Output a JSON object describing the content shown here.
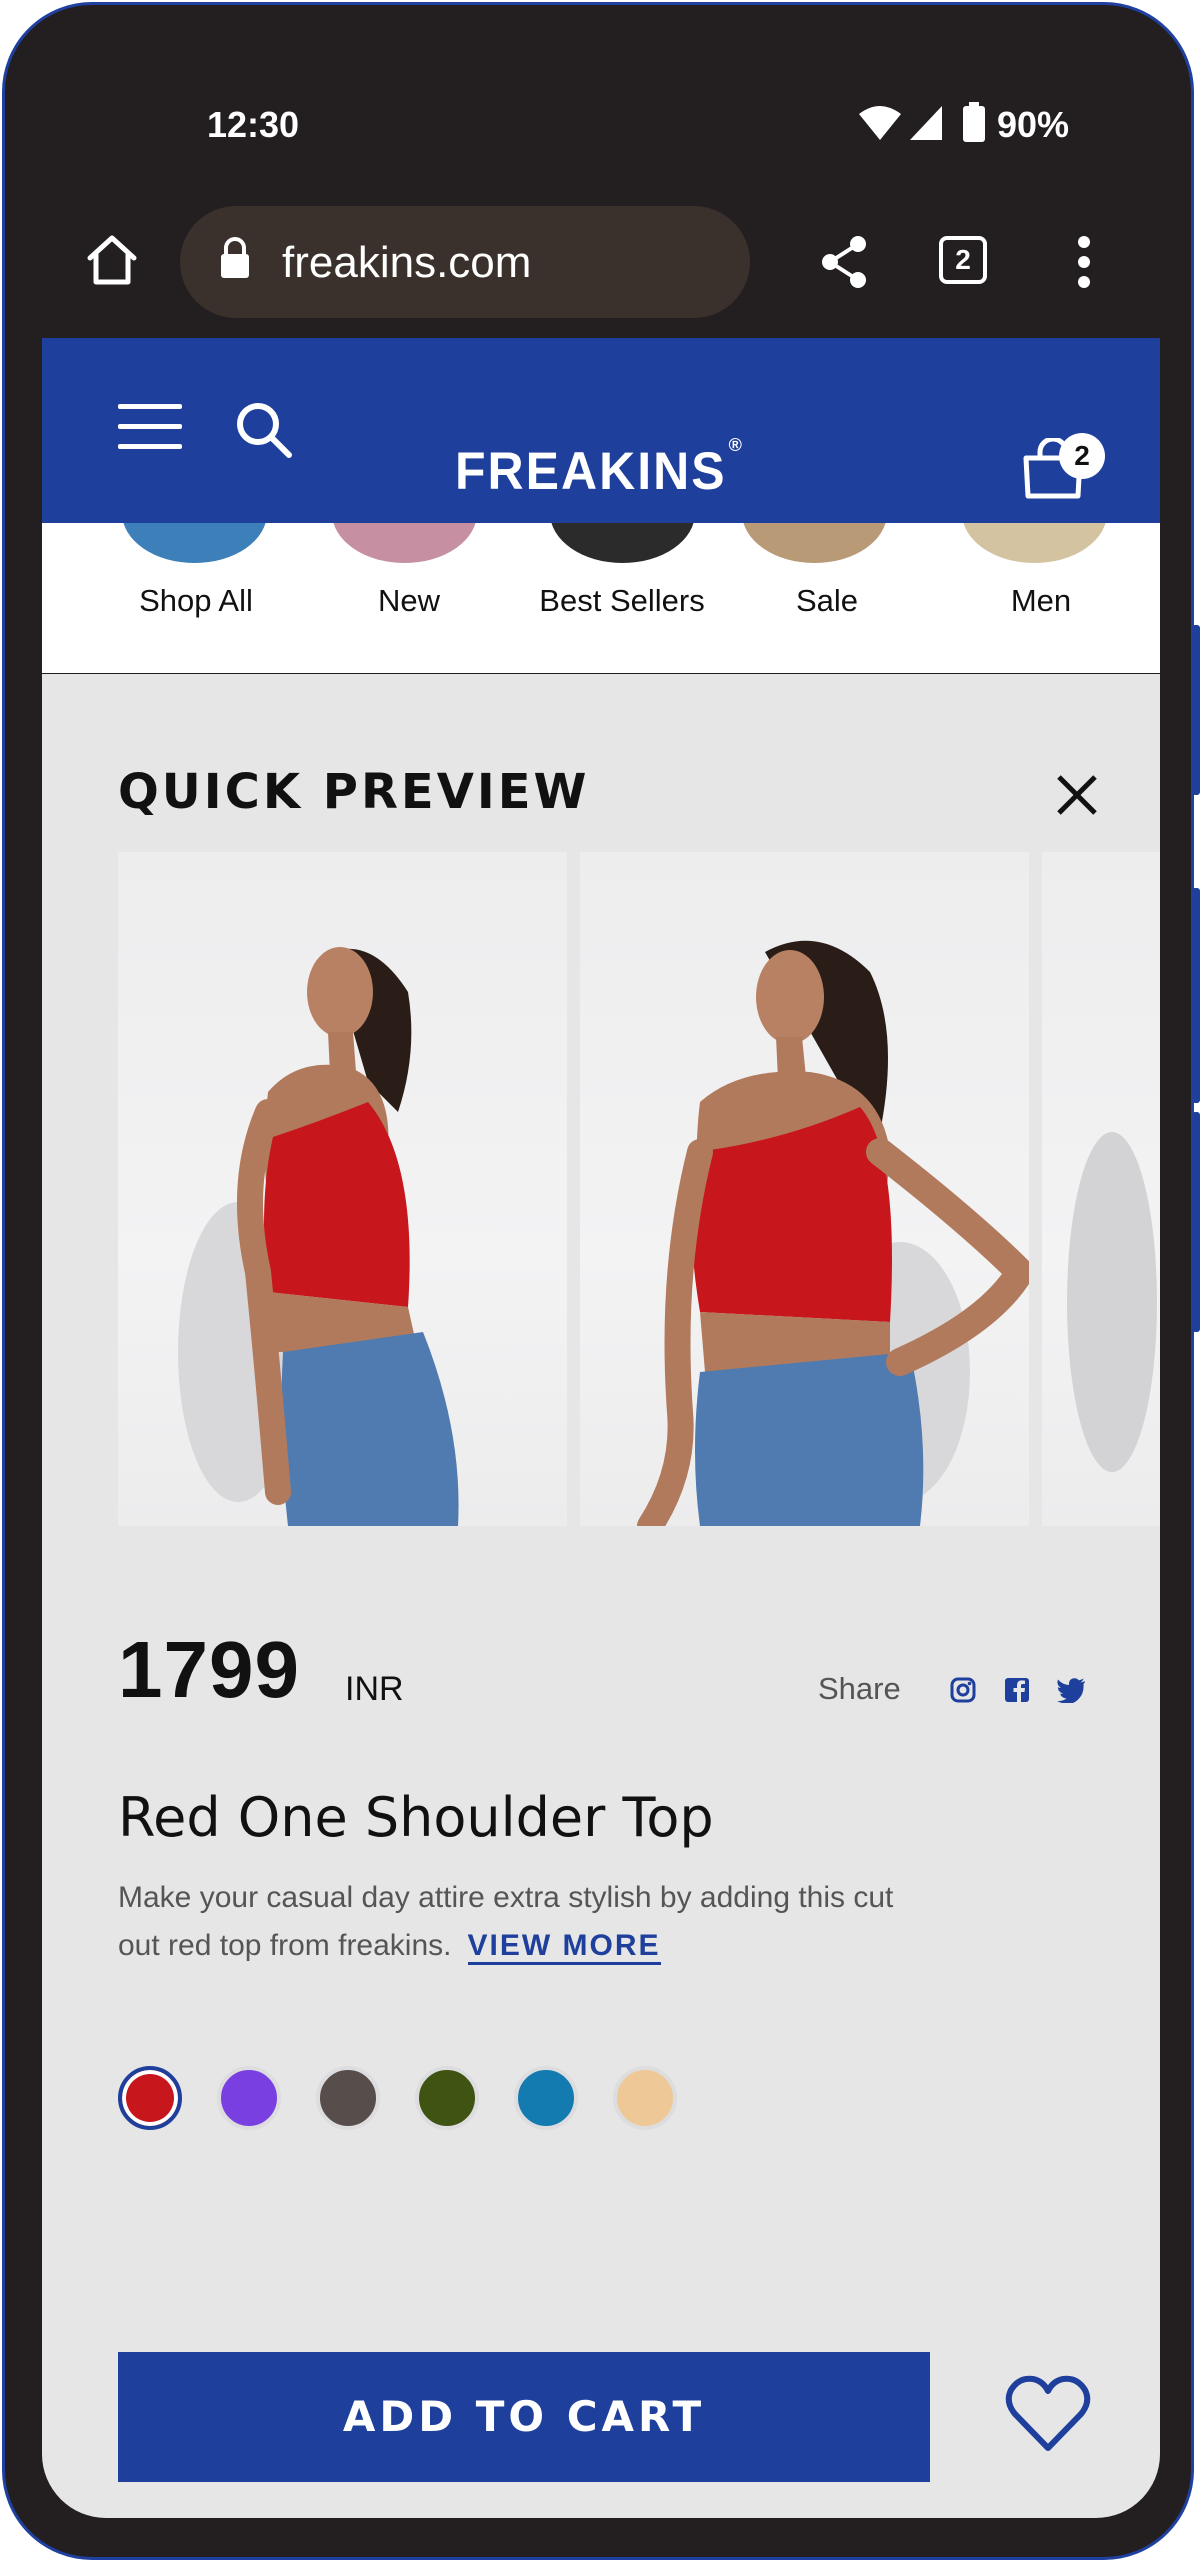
{
  "status_bar": {
    "time": "12:30",
    "battery": "90%"
  },
  "browser": {
    "url": "freakins.com",
    "tab_count": "2"
  },
  "site": {
    "logo": "FREAKINS",
    "logo_mark": "®",
    "cart_count": "2"
  },
  "categories": [
    {
      "label": "Shop All"
    },
    {
      "label": "New"
    },
    {
      "label": "Best Sellers"
    },
    {
      "label": "Sale"
    },
    {
      "label": "Men"
    }
  ],
  "modal": {
    "title": "QUICK PREVIEW",
    "price": "1799",
    "currency": "INR",
    "share_label": "Share",
    "product_name": "Red One Shoulder Top",
    "description": "Make your casual day attire extra stylish by adding this cut out red top from freakins.",
    "view_more": "VIEW MORE",
    "colors": [
      "#c8161d",
      "#7a3fe0",
      "#574d4a",
      "#3f5412",
      "#137bb0",
      "#eec896"
    ],
    "selected_color_index": 0,
    "add_to_cart": "ADD TO CART"
  },
  "theme": {
    "brand": "#1e3f9c",
    "modal_bg": "#e6e6e7"
  },
  "icons": [
    "home-icon",
    "lock-icon",
    "share-icon",
    "tabs-icon",
    "more-icon",
    "menu-icon",
    "search-icon",
    "cart-icon",
    "close-icon",
    "instagram-icon",
    "facebook-icon",
    "twitter-icon",
    "heart-icon"
  ]
}
